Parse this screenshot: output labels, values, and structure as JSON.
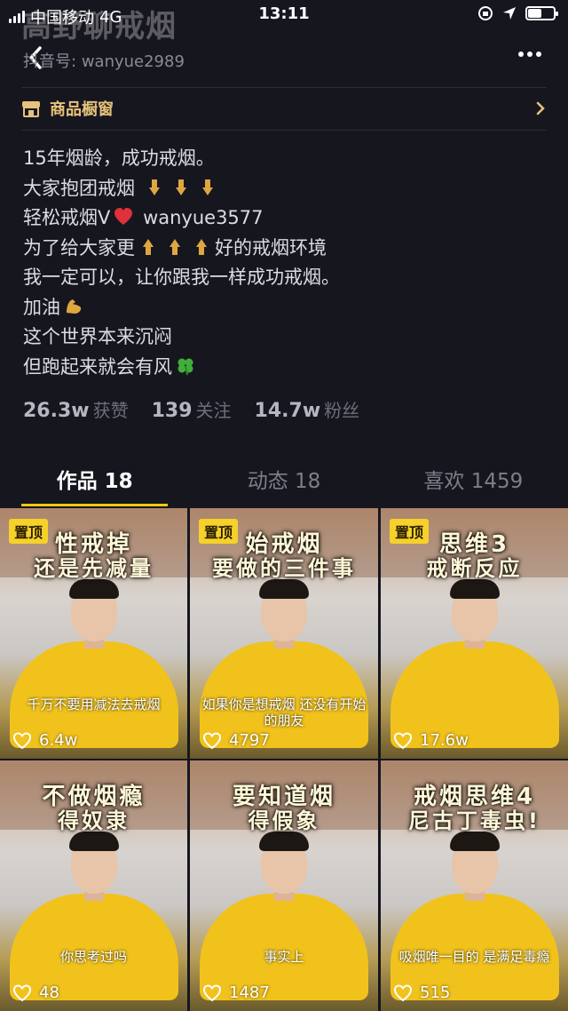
{
  "status_bar": {
    "carrier": "中国移动",
    "network": "4G",
    "time": "13:11",
    "battery_level": 0.55
  },
  "header": {
    "name": "高野聊戒烟",
    "douyin_label": "抖音号:",
    "douyin_id": "wanyue2989"
  },
  "store": {
    "label": "商品橱窗"
  },
  "bio": {
    "line1": "15年烟龄，成功戒烟。",
    "line2": "大家抱团戒烟",
    "line3_a": "轻松戒烟V",
    "line3_b": "wanyue3577",
    "line4_a": "为了给大家更",
    "line4_b": "好的戒烟环境",
    "line5": "我一定可以，让你跟我一样成功戒烟。",
    "line6": "加油",
    "line7": "这个世界本来沉闷",
    "line8": "但跑起来就会有风"
  },
  "stats": {
    "likes_num": "26.3w",
    "likes_label": "获赞",
    "following_num": "139",
    "following_label": "关注",
    "followers_num": "14.7w",
    "followers_label": "粉丝"
  },
  "tabs": {
    "works": "作品 18",
    "moments": "动态 18",
    "favorites": "喜欢 1459"
  },
  "videos": [
    {
      "pin": "置顶",
      "cap1": "性戒掉",
      "cap2": "还是先减量",
      "sub": "千万不要用减法去戒烟",
      "likes": "6.4w"
    },
    {
      "pin": "置顶",
      "cap1": "始戒烟",
      "cap2": "要做的三件事",
      "sub": "如果你是想戒烟 还没有开始的朋友",
      "likes": "4797"
    },
    {
      "pin": "置顶",
      "cap1": "思维3",
      "cap2": "戒断反应",
      "sub": "",
      "likes": "17.6w"
    },
    {
      "pin": "",
      "cap1": "不做烟瘾",
      "cap2": "得奴隶",
      "sub": "你思考过吗",
      "likes": "48"
    },
    {
      "pin": "",
      "cap1": "要知道烟",
      "cap2": "得假象",
      "sub": "事实上",
      "likes": "1487"
    },
    {
      "pin": "",
      "cap1": "戒烟思维4",
      "cap2": "尼古丁毒虫!",
      "sub": "吸烟唯一目的 是满足毒瘾",
      "likes": "515"
    }
  ],
  "colors": {
    "background": "#16161f",
    "accent_yellow": "#f2c812",
    "store_gold": "#e6c27a"
  }
}
